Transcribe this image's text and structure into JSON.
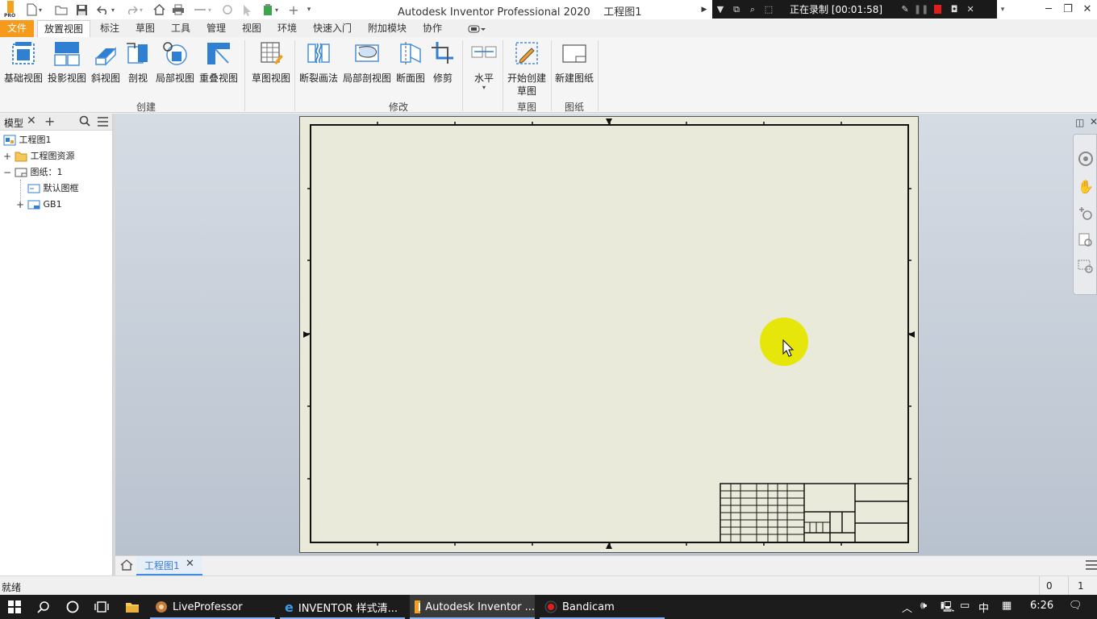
{
  "window": {
    "title": "Autodesk Inventor Professional 2020",
    "document": "工程图1"
  },
  "recorder": {
    "status": "正在录制 [00:01:58]"
  },
  "ribbon_tabs": [
    "文件",
    "放置视图",
    "标注",
    "草图",
    "工具",
    "管理",
    "视图",
    "环境",
    "快速入门",
    "附加模块",
    "协作"
  ],
  "ribbon": {
    "create": {
      "label": "创建",
      "buttons": [
        "基础视图",
        "投影视图",
        "斜视图",
        "剖视",
        "局部视图",
        "重叠视图"
      ]
    },
    "sketch_view": "草图视图",
    "modify": {
      "label": "修改",
      "buttons": [
        "断裂画法",
        "局部剖视图",
        "断面图",
        "修剪"
      ]
    },
    "align": "水平",
    "sketch": {
      "label": "草图",
      "button_line1": "开始创建",
      "button_line2": "草图"
    },
    "sheets": {
      "label": "图纸",
      "button": "新建图纸"
    }
  },
  "browser": {
    "title": "模型",
    "tree": [
      {
        "label": "工程图1",
        "level": 0,
        "expander": ""
      },
      {
        "label": "工程图资源",
        "level": 0,
        "expander": "+"
      },
      {
        "label": "图纸：1",
        "level": 0,
        "expander": "−"
      },
      {
        "label": "默认图框",
        "level": 1,
        "expander": ""
      },
      {
        "label": "GB1",
        "level": 1,
        "expander": "+"
      }
    ]
  },
  "doc_tabs": {
    "active": "工程图1"
  },
  "status": {
    "text": "就绪",
    "count_a": "0",
    "count_b": "1"
  },
  "taskbar": {
    "apps": [
      "LiveProfessor",
      "INVENTOR 样式清...",
      "Autodesk Inventor ...",
      "Bandicam"
    ],
    "tray_ime": "中",
    "time": "6:26"
  },
  "colors": {
    "file_tab": "#f59a1b",
    "sheet": "#eaeadb",
    "cursor_highlight": "#e6e60a",
    "accent_blue": "#3a7bd5"
  }
}
